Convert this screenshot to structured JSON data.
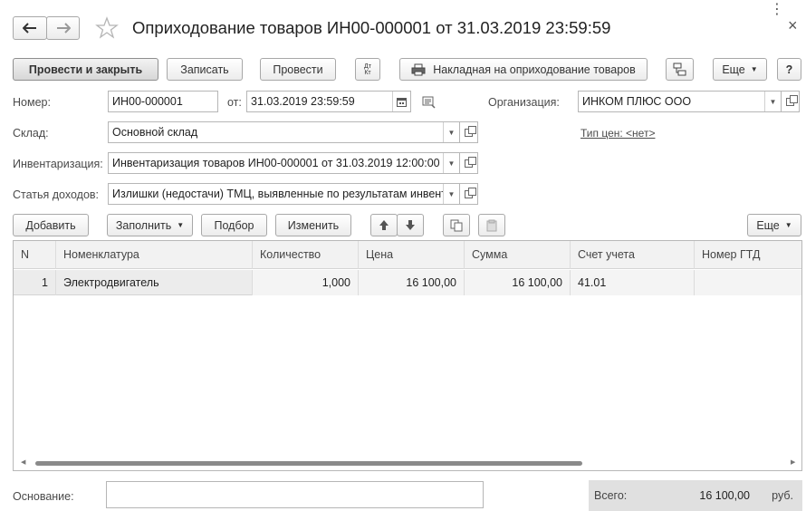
{
  "window": {
    "title": "Оприходование товаров ИН00-000001 от 31.03.2019 23:59:59",
    "more_menu_glyph": "⋮",
    "close_glyph": "×"
  },
  "toolbar": {
    "post_close": "Провести и закрыть",
    "save": "Записать",
    "post": "Провести",
    "dt_kt": "Дт\nКт",
    "print": "Накладная на оприходование товаров",
    "more": "Еще",
    "help": "?"
  },
  "form": {
    "number_label": "Номер:",
    "number_value": "ИН00-000001",
    "date_label": "от:",
    "date_value": "31.03.2019 23:59:59",
    "org_label": "Организация:",
    "org_value": "ИНКОМ ПЛЮС ООО",
    "price_type_link": "Тип цен: <нет>",
    "warehouse_label": "Склад:",
    "warehouse_value": "Основной склад",
    "inventory_label": "Инвентаризация:",
    "inventory_value": "Инвентаризация товаров ИН00-000001 от 31.03.2019 12:00:00",
    "income_label": "Статья доходов:",
    "income_value": "Излишки (недостачи) ТМЦ, выявленные по результатам инвентаризации"
  },
  "table_toolbar": {
    "add": "Добавить",
    "fill": "Заполнить",
    "select": "Подбор",
    "change": "Изменить",
    "more": "Еще"
  },
  "table": {
    "columns": [
      "N",
      "Номенклатура",
      "Количество",
      "Цена",
      "Сумма",
      "Счет учета",
      "Номер ГТД"
    ],
    "rows": [
      {
        "n": "1",
        "item": "Электродвигатель",
        "qty": "1,000",
        "price": "16 100,00",
        "sum": "16 100,00",
        "account": "41.01",
        "gtd": ""
      }
    ]
  },
  "footer": {
    "basis_label": "Основание:",
    "basis_value": "",
    "total_label": "Всего:",
    "total_value": "16 100,00",
    "currency": "руб."
  },
  "colors": {
    "selected_row": "#ececec",
    "total_bg": "#e0e0e0",
    "link": "#4a4a4a"
  }
}
